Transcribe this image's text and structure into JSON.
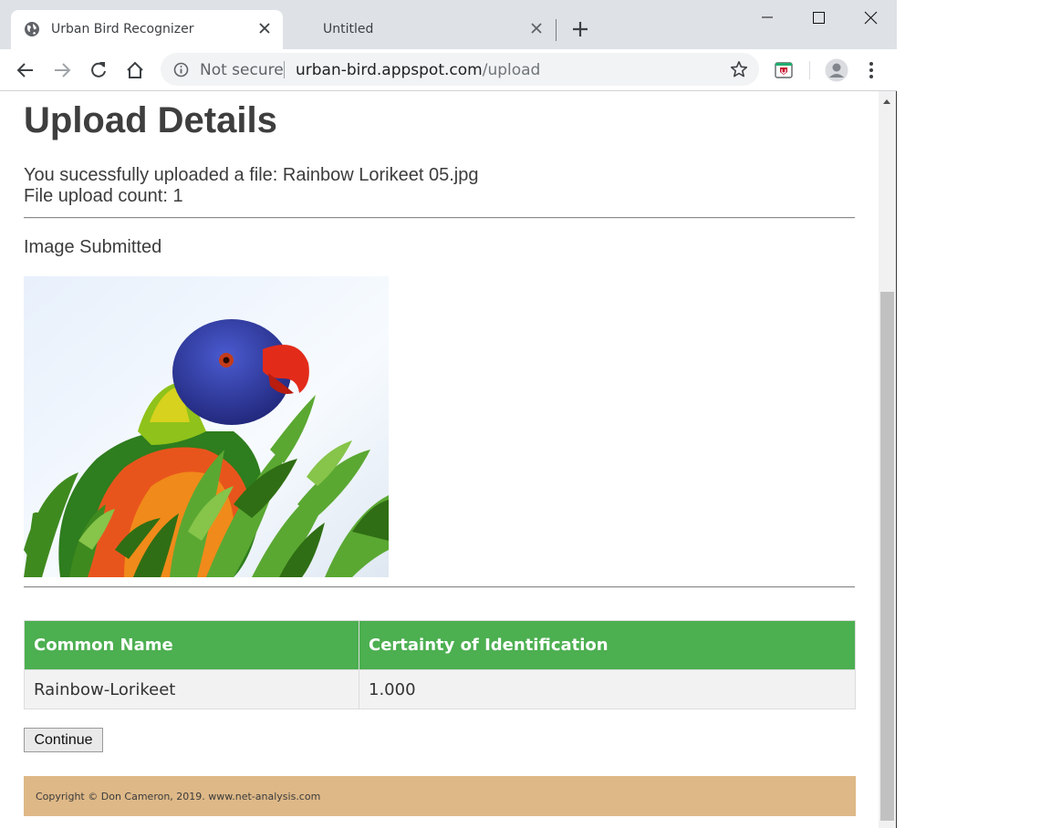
{
  "browser": {
    "tabs": [
      {
        "title": "Urban Bird Recognizer",
        "active": true,
        "icon": "globe-icon"
      },
      {
        "title": "Untitled",
        "active": false
      }
    ],
    "new_tab_icon": "plus-icon",
    "window_controls": [
      "minimize-icon",
      "maximize-icon",
      "close-icon"
    ],
    "toolbar": {
      "security_label": "Not secure",
      "url_host": "urban-bird.appspot.com",
      "url_path": "/upload",
      "icons": [
        "back-icon",
        "forward-icon",
        "reload-icon",
        "home-icon",
        "info-icon",
        "star-icon",
        "extension-icon",
        "profile-icon",
        "menu-icon"
      ]
    }
  },
  "page": {
    "title": "Upload Details",
    "upload_message": "You sucessfully uploaded a file: Rainbow Lorikeet 05.jpg",
    "upload_count": "File upload count: 1",
    "image_section_label": "Image Submitted",
    "results_table": {
      "headers": [
        "Common Name",
        "Certainty of Identification"
      ],
      "rows": [
        [
          "Rainbow-Lorikeet",
          "1.000"
        ]
      ]
    },
    "continue_label": "Continue",
    "footer_text": "Copyright © Don Cameron, 2019. www.net-analysis.com"
  },
  "colors": {
    "table_header": "#4caf50",
    "footer_bg": "#deb887",
    "tabstrip_bg": "#dee1e6"
  }
}
